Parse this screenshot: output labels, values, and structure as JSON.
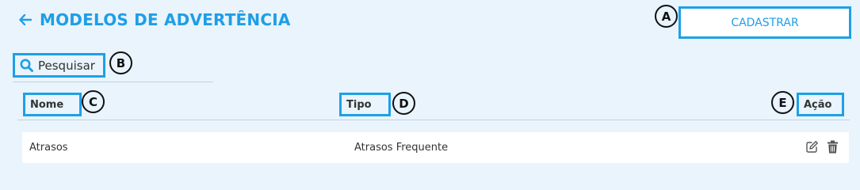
{
  "header": {
    "title": "MODELOS DE ADVERTÊNCIA",
    "back_icon": "arrow-left-icon"
  },
  "toolbar": {
    "cadastrar_label": "CADASTRAR"
  },
  "search": {
    "placeholder": "Pesquisar",
    "value": ""
  },
  "table": {
    "columns": [
      "Nome",
      "Tipo",
      "Ação"
    ],
    "rows": [
      {
        "nome": "Atrasos",
        "tipo": "Atrasos Frequente",
        "actions": [
          "edit-icon",
          "trash-icon"
        ]
      }
    ]
  },
  "markers": [
    "A",
    "B",
    "C",
    "D",
    "E"
  ],
  "colors": {
    "accent": "#1ea0e6",
    "background": "#e9f4fc",
    "text": "#333333"
  }
}
